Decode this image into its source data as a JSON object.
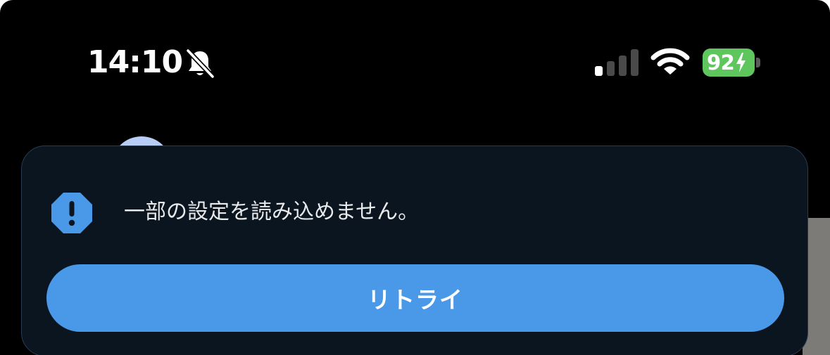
{
  "status_bar": {
    "time": "14:10",
    "silent_icon": "bell-slash-icon",
    "signal_icon": "cellular-signal-icon",
    "signal_bars_active": 1,
    "signal_bars_total": 4,
    "wifi_icon": "wifi-icon",
    "battery_level": "92",
    "battery_charging": true,
    "battery_color": "#5ec65c"
  },
  "toast": {
    "icon": "warning-octagon-icon",
    "icon_color": "#4a98e8",
    "message": "一部の設定を読み込めません。",
    "retry_label": "リトライ",
    "button_color": "#4a98e8",
    "background_color": "#0b1520"
  }
}
